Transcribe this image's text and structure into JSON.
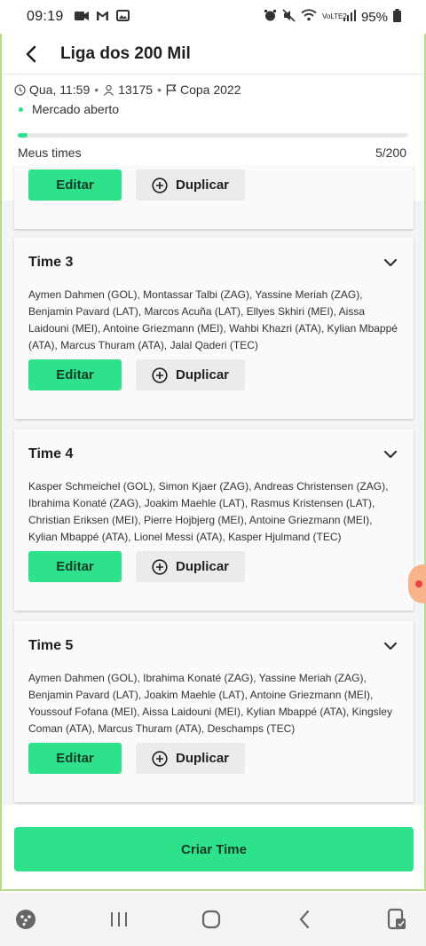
{
  "status_bar": {
    "time": "09:19",
    "battery": "95%",
    "network": "VoLTE2"
  },
  "header": {
    "title": "Liga dos 200 Mil"
  },
  "info": {
    "date": "Qua, 11:59",
    "participants": "13175",
    "competition": "Copa 2022",
    "market_status": "Mercado aberto",
    "progress_label": "Meus times",
    "progress_count": "5/200",
    "progress_fraction": 0.025
  },
  "buttons": {
    "edit": "Editar",
    "duplicate": "Duplicar",
    "create": "Criar Time"
  },
  "teams": [
    {
      "name": "Time 3",
      "players": "Aymen Dahmen (GOL), Montassar Talbi (ZAG), Yassine Meriah (ZAG), Benjamin Pavard (LAT), Marcos Acuña (LAT), Ellyes Skhiri (MEI), Aissa Laidouni (MEI), Antoine Griezmann (MEI), Wahbi Khazri (ATA), Kylian Mbappé (ATA), Marcus Thuram (ATA), Jalal Qaderi (TEC)"
    },
    {
      "name": "Time 4",
      "players": "Kasper Schmeichel (GOL), Simon Kjaer (ZAG), Andreas Christensen (ZAG), Ibrahima Konaté (ZAG), Joakim Maehle (LAT), Rasmus Kristensen (LAT), Christian Eriksen (MEI), Pierre Hojbjerg (MEI), Antoine Griezmann (MEI), Kylian Mbappé (ATA), Lionel Messi (ATA), Kasper Hjulmand (TEC)"
    },
    {
      "name": "Time 5",
      "players": "Aymen Dahmen (GOL), Ibrahima Konaté (ZAG), Yassine Meriah (ZAG), Benjamin Pavard (LAT), Joakim Maehle (LAT), Antoine Griezmann (MEI), Youssouf Fofana (MEI), Aissa Laidouni (MEI), Kylian Mbappé (ATA), Kingsley Coman (ATA), Marcus Thuram (ATA), Deschamps (TEC)"
    }
  ],
  "colors": {
    "accent": "#2ee28b",
    "frame": "#b9d98a"
  }
}
